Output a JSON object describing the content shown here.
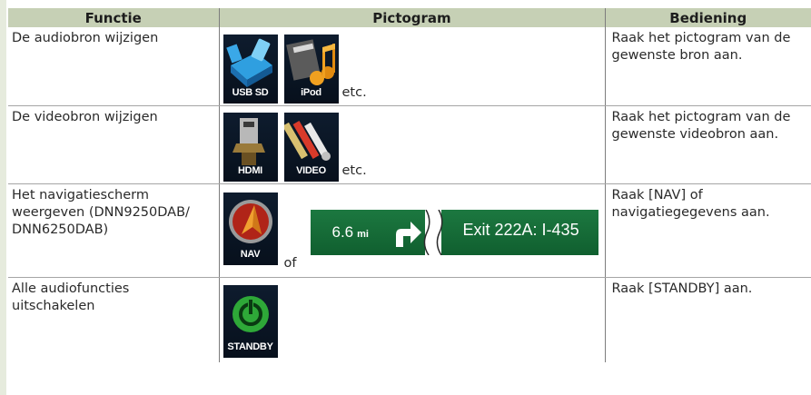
{
  "headers": {
    "functie": "Functie",
    "pictogram": "Pictogram",
    "bediening": "Bediening"
  },
  "rows": [
    {
      "functie": "De audiobron wijzigen",
      "icons": [
        {
          "label": "USB SD",
          "name": "usb-sd-icon"
        },
        {
          "label": "iPod",
          "name": "ipod-icon"
        }
      ],
      "suffix": "etc.",
      "bediening": "Raak het pictogram van de gewenste bron aan."
    },
    {
      "functie": "De videobron wijzigen",
      "icons": [
        {
          "label": "HDMI",
          "name": "hdmi-icon"
        },
        {
          "label": "VIDEO",
          "name": "video-icon"
        }
      ],
      "suffix": "etc.",
      "bediening": "Raak het pictogram van de gewenste videobron aan."
    },
    {
      "functie": "Het navigatiescherm weergeven (DNN9250DAB/ DNN6250DAB)",
      "icons": [
        {
          "label": "NAV",
          "name": "nav-icon"
        }
      ],
      "connector": "of",
      "nav_bar": {
        "distance": "6.6",
        "distance_unit": "mi",
        "exit": "Exit 222A: I-435"
      },
      "bediening": "Raak [NAV] of navigatiegegevens aan."
    },
    {
      "functie": "Alle audiofuncties uitschakelen",
      "icons": [
        {
          "label": "STANDBY",
          "name": "standby-icon"
        }
      ],
      "bediening": "Raak [STANDBY] aan."
    }
  ]
}
